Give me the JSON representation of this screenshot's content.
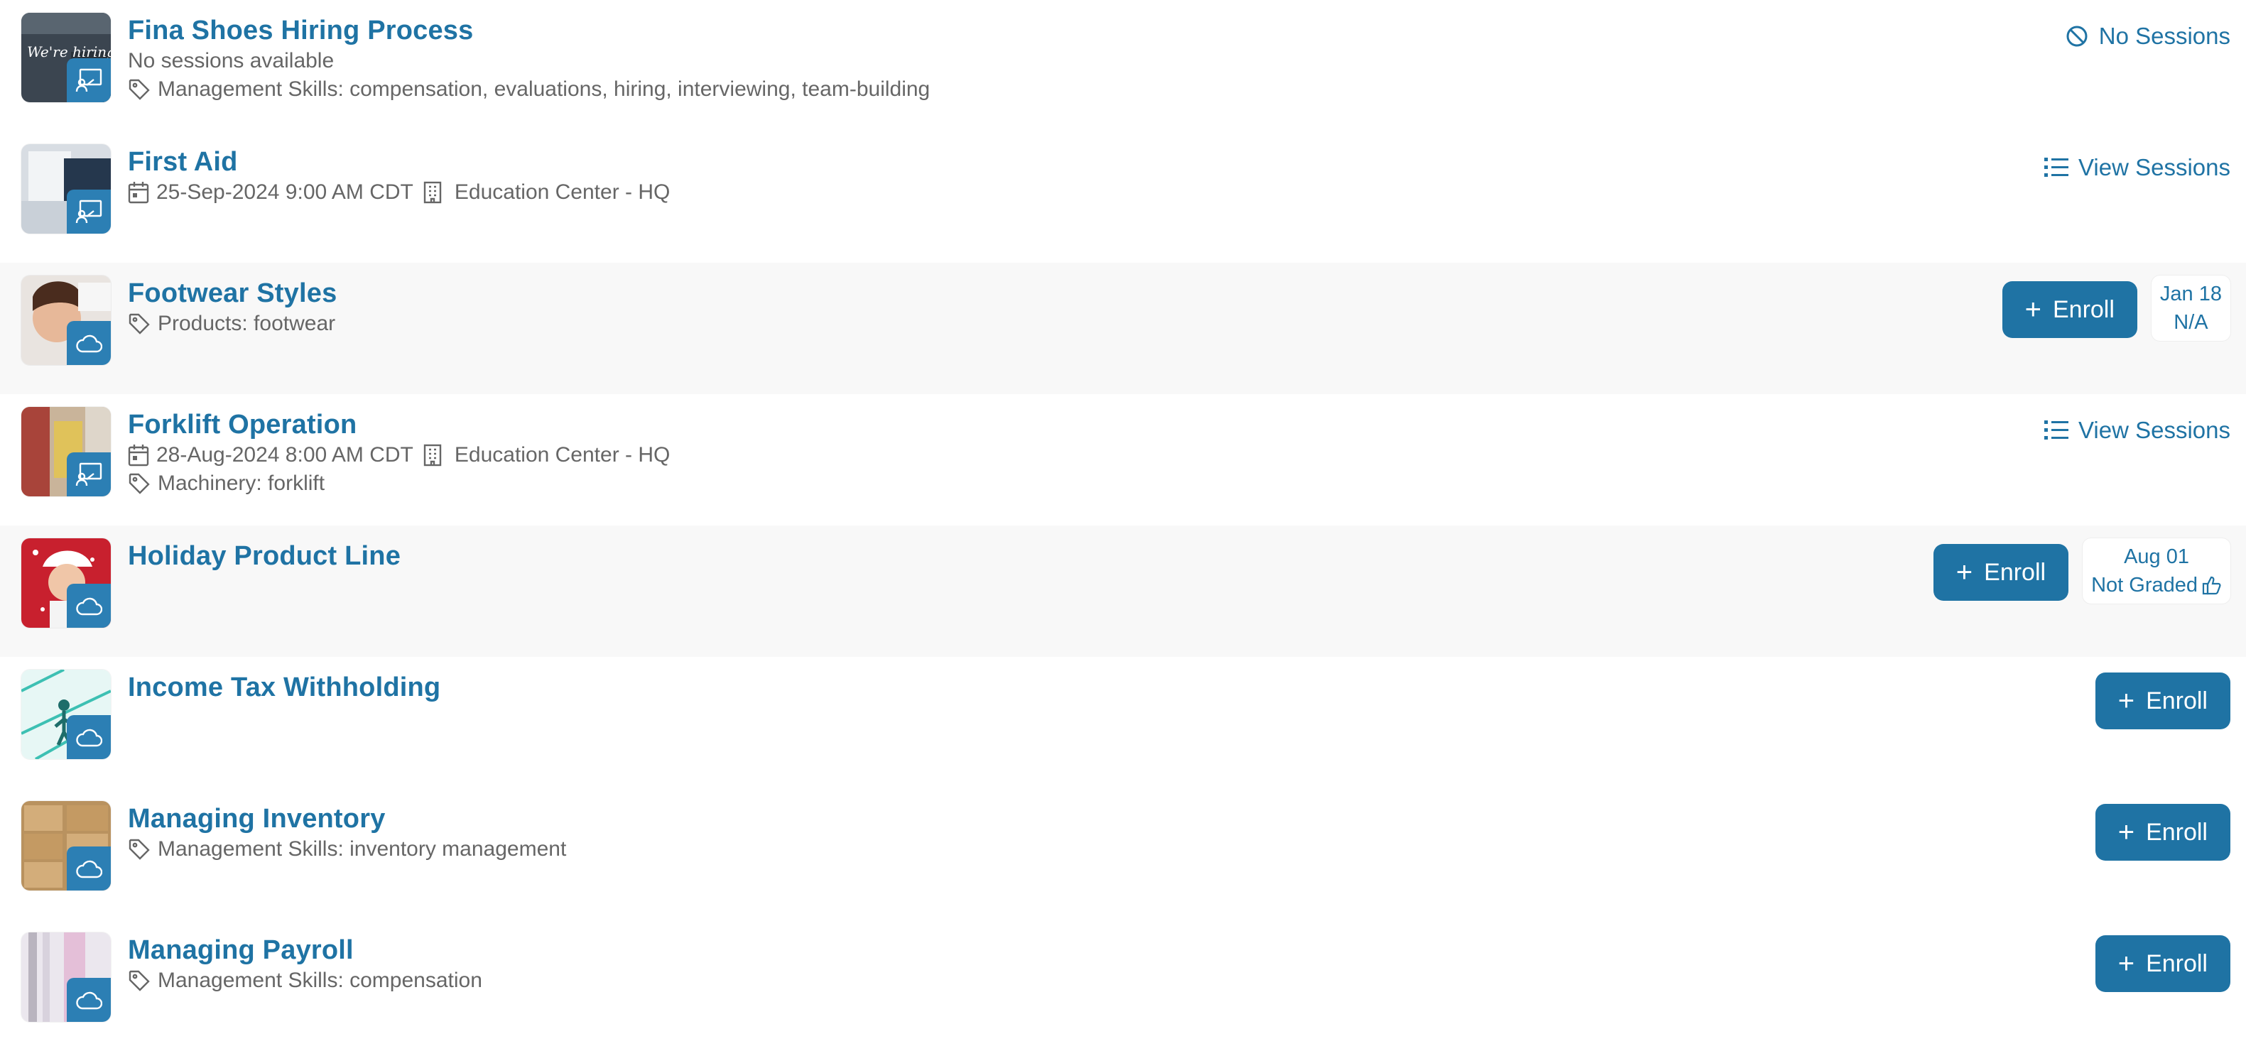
{
  "courses": [
    {
      "title": "Fina Shoes Hiring Process",
      "subtitle": "No sessions available",
      "tags": "Management Skills: compensation, evaluations, hiring, interviewing, team-building",
      "thumb_text": "We're hiring",
      "type_icon": "classroom-icon",
      "action": {
        "label": "No Sessions",
        "icon": "no-sessions-icon"
      }
    },
    {
      "title": "First Aid",
      "session_date": "25-Sep-2024 9:00 AM CDT",
      "location": "Education Center - HQ",
      "type_icon": "classroom-icon",
      "action": {
        "label": "View Sessions",
        "icon": "list-icon"
      }
    },
    {
      "title": "Footwear Styles",
      "tags": "Products: footwear",
      "type_icon": "cloud-icon",
      "enroll_label": "Enroll",
      "badge": {
        "date": "Jan 18",
        "status": "N/A"
      }
    },
    {
      "title": "Forklift Operation",
      "session_date": "28-Aug-2024 8:00 AM CDT",
      "location": "Education Center - HQ",
      "tags": "Machinery: forklift",
      "type_icon": "classroom-icon",
      "action": {
        "label": "View Sessions",
        "icon": "list-icon"
      }
    },
    {
      "title": "Holiday Product Line",
      "type_icon": "cloud-icon",
      "enroll_label": "Enroll",
      "badge": {
        "date": "Aug 01",
        "status": "Not Graded"
      }
    },
    {
      "title": "Income Tax Withholding",
      "type_icon": "cloud-icon",
      "enroll_label": "Enroll"
    },
    {
      "title": "Managing Inventory",
      "tags": "Management Skills: inventory management",
      "type_icon": "cloud-icon",
      "enroll_label": "Enroll"
    },
    {
      "title": "Managing Payroll",
      "tags": "Management Skills: compensation",
      "type_icon": "cloud-icon",
      "enroll_label": "Enroll"
    }
  ],
  "colors": {
    "accent": "#1f73a4",
    "badge_bg": "#2c7fb4",
    "shaded_row": "#f8f8f8"
  }
}
